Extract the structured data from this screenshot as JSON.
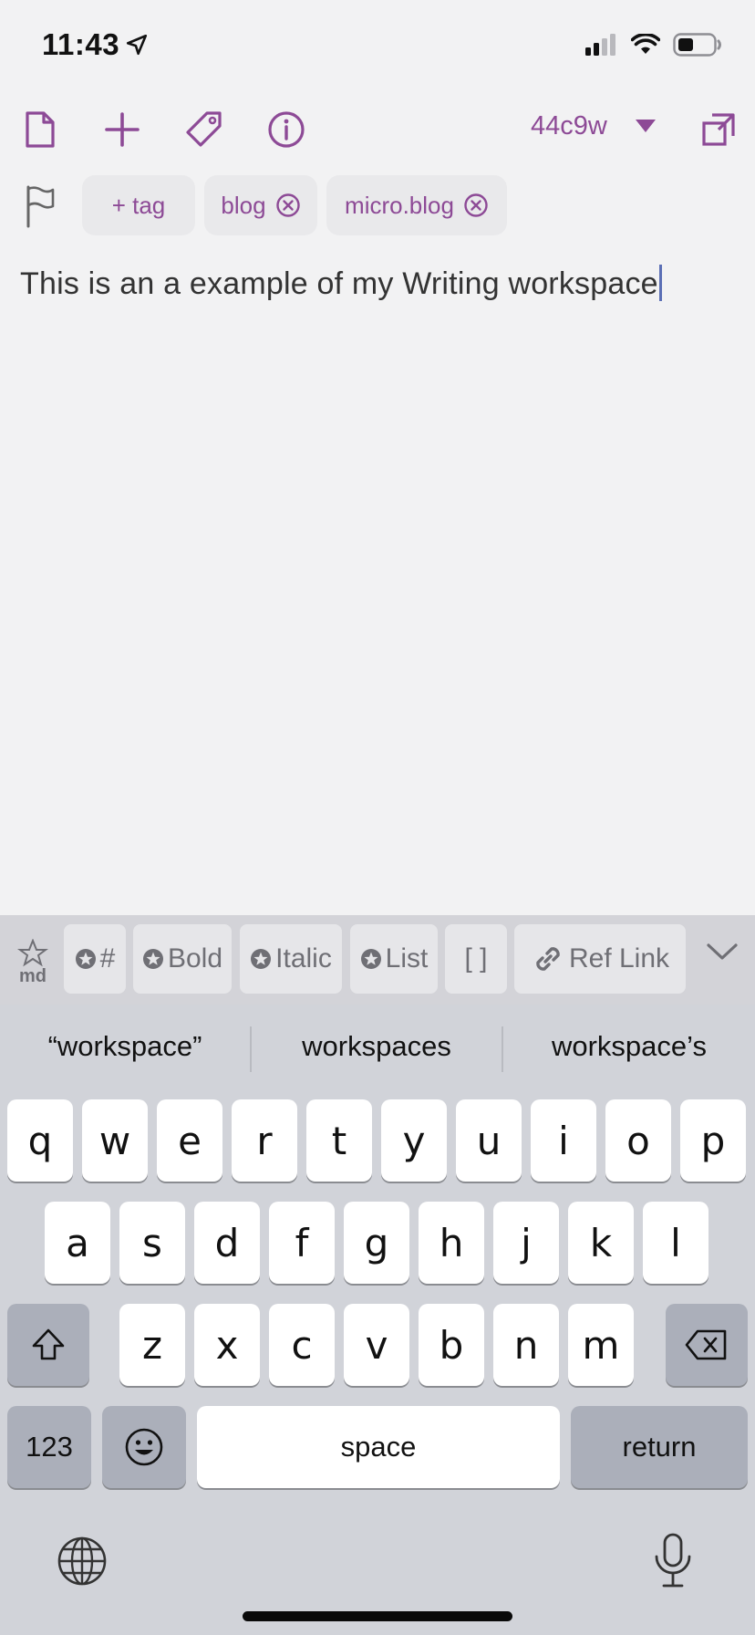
{
  "status": {
    "time": "11:43"
  },
  "toolbar": {
    "note_id": "44c9w",
    "accent": "#8d4a96",
    "icons": [
      "document-icon",
      "plus-icon",
      "tag-icon",
      "info-icon",
      "dropdown-caret-icon",
      "expand-icon"
    ]
  },
  "tags": {
    "add_label": "+ tag",
    "items": [
      {
        "label": "blog"
      },
      {
        "label": "micro.blog"
      }
    ]
  },
  "editor": {
    "text": "This is an a example of my Writing workspace"
  },
  "md_toolbar": {
    "buttons": [
      {
        "label": "#"
      },
      {
        "label": "Bold"
      },
      {
        "label": "Italic"
      },
      {
        "label": "List"
      },
      {
        "label": "[ ]"
      },
      {
        "label": "Ref Link"
      }
    ]
  },
  "keyboard": {
    "suggestions": [
      "“workspace”",
      "workspaces",
      "workspace’s"
    ],
    "row1": [
      "q",
      "w",
      "e",
      "r",
      "t",
      "y",
      "u",
      "i",
      "o",
      "p"
    ],
    "row2": [
      "a",
      "s",
      "d",
      "f",
      "g",
      "h",
      "j",
      "k",
      "l"
    ],
    "row3": [
      "z",
      "x",
      "c",
      "v",
      "b",
      "n",
      "m"
    ],
    "numbers_label": "123",
    "space_label": "space",
    "return_label": "return"
  }
}
